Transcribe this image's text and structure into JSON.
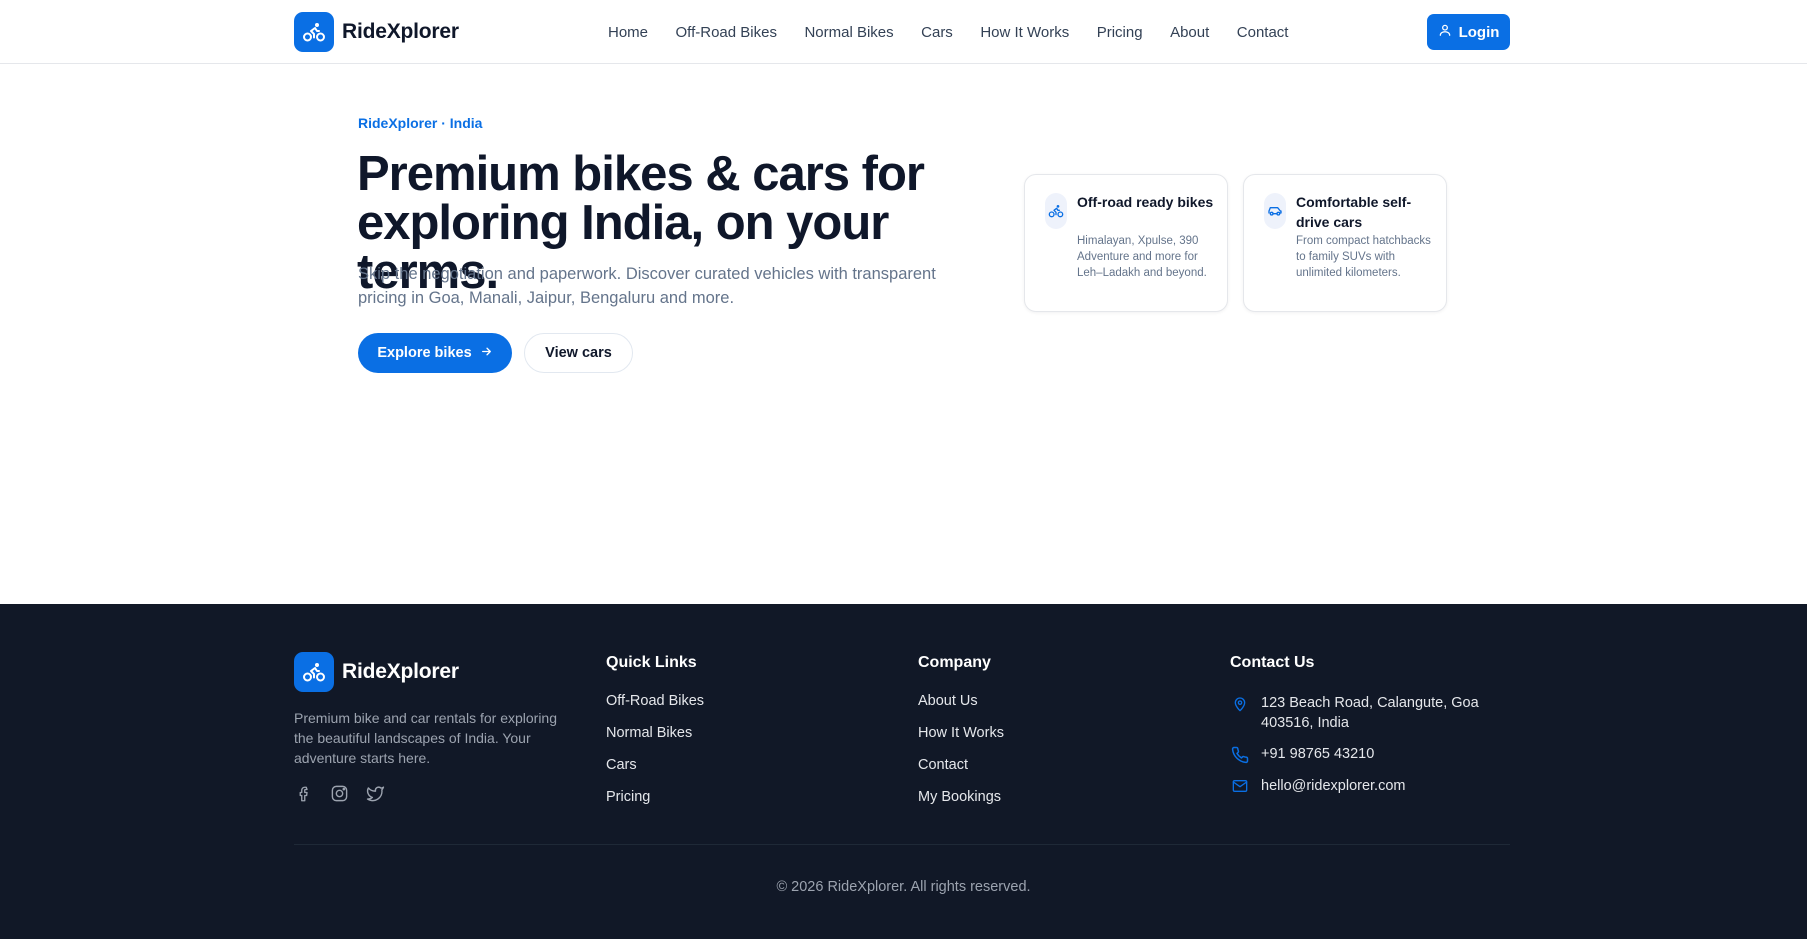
{
  "brand": {
    "name": "RideXplorer",
    "accent": "#0a6fe4",
    "logo_icon": "bicycle-icon"
  },
  "nav": {
    "items": [
      {
        "label": "Home"
      },
      {
        "label": "Off-Road Bikes"
      },
      {
        "label": "Normal Bikes"
      },
      {
        "label": "Cars"
      },
      {
        "label": "How It Works"
      },
      {
        "label": "Pricing"
      },
      {
        "label": "About"
      },
      {
        "label": "Contact"
      }
    ],
    "login_label": "Login",
    "login_icon": "user-icon"
  },
  "hero": {
    "eyebrow": "RideXplorer · India",
    "title_line1": "Premium bikes & cars for",
    "title_line2": "exploring India, on your terms.",
    "subtitle": "Skip the negotiation and paperwork. Discover curated vehicles with transparent pricing in Goa, Manali, Jaipur, Bengaluru and more.",
    "primary_cta": "Explore bikes",
    "primary_cta_icon": "arrow-right-icon",
    "secondary_cta": "View cars"
  },
  "features": [
    {
      "icon": "bicycle-icon",
      "title": "Off-road ready bikes",
      "description": "Himalayan, Xpulse, 390 Adventure and more for Leh–Ladakh and beyond."
    },
    {
      "icon": "car-icon",
      "title": "Comfortable self-drive cars",
      "description": "From compact hatchbacks to family SUVs with unlimited kilometers."
    }
  ],
  "footer": {
    "description": "Premium bike and car rentals for exploring the beautiful landscapes of India. Your adventure starts here.",
    "socials": [
      "facebook-icon",
      "instagram-icon",
      "twitter-icon"
    ],
    "quick_links": {
      "heading": "Quick Links",
      "items": [
        "Off-Road Bikes",
        "Normal Bikes",
        "Cars",
        "Pricing"
      ]
    },
    "company": {
      "heading": "Company",
      "items": [
        "About Us",
        "How It Works",
        "Contact",
        "My Bookings"
      ]
    },
    "contact": {
      "heading": "Contact Us",
      "address_line1": "123 Beach Road, Calangute, Goa",
      "address_line2": "403516, India",
      "phone": "+91 98765 43210",
      "email": "hello@ridexplorer.com"
    },
    "copyright": "© 2026 RideXplorer. All rights reserved."
  },
  "colors": {
    "footer_bg": "#111827",
    "text_dark": "#0f172a",
    "text_muted": "#64748b"
  }
}
